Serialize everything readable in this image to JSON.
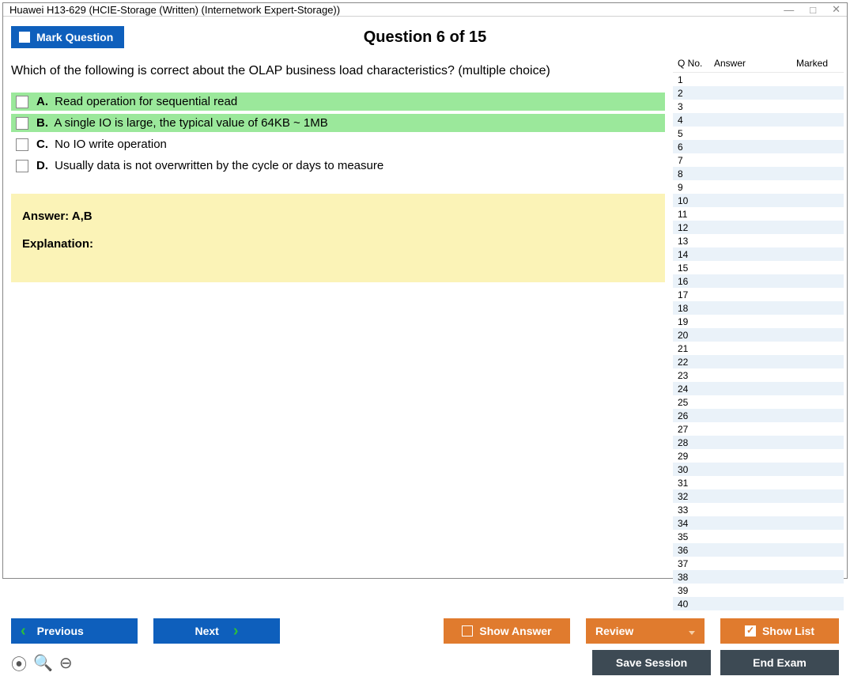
{
  "window": {
    "title": "Huawei H13-629 (HCIE-Storage (Written) (Internetwork Expert-Storage))"
  },
  "toolbar": {
    "mark_label": "Mark Question",
    "question_num": "Question 6 of 15"
  },
  "question": {
    "text": "Which of the following is correct about the OLAP business load characteristics? (multiple choice)",
    "options": [
      {
        "letter": "A.",
        "text": "Read operation for sequential read",
        "correct": true
      },
      {
        "letter": "B.",
        "text": "A single IO is large, the typical value of 64KB ~ 1MB",
        "correct": true
      },
      {
        "letter": "C.",
        "text": "No IO write operation",
        "correct": false
      },
      {
        "letter": "D.",
        "text": "Usually data is not overwritten by the cycle or days to measure",
        "correct": false
      }
    ],
    "answer_label": "Answer: ",
    "answer_value": "A,B",
    "explanation_label": "Explanation:",
    "explanation_text": ""
  },
  "qlist": {
    "headers": {
      "qno": "Q No.",
      "answer": "Answer",
      "marked": "Marked"
    },
    "count": 40
  },
  "buttons": {
    "previous": "Previous",
    "next": "Next",
    "show_answer": "Show Answer",
    "review": "Review",
    "show_list": "Show List",
    "save_session": "Save Session",
    "end_exam": "End Exam"
  }
}
